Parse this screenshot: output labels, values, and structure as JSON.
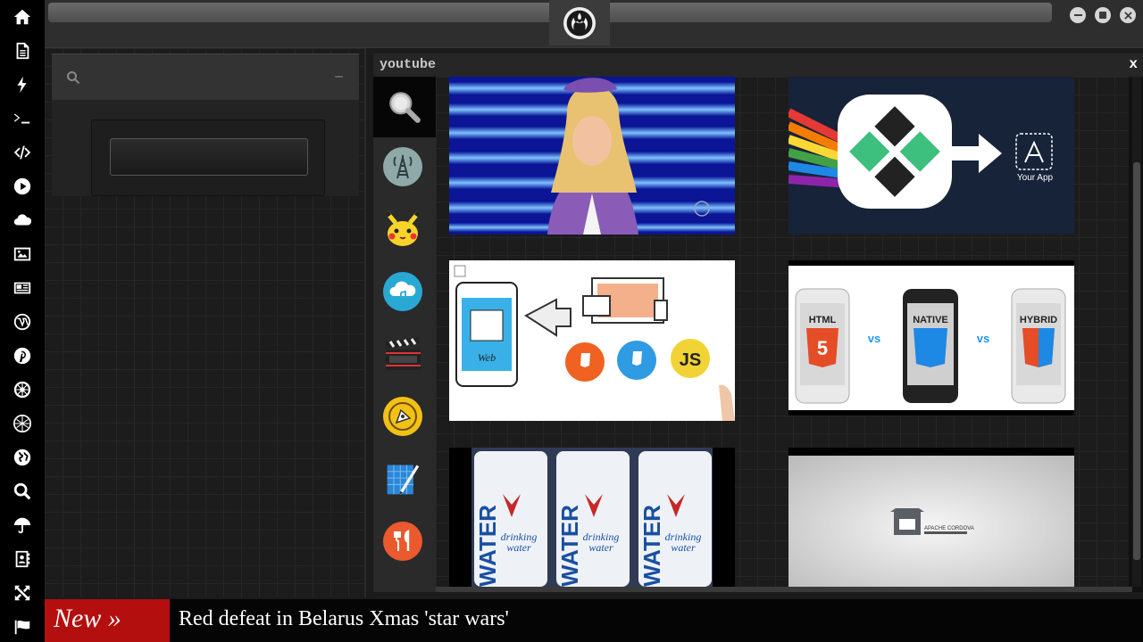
{
  "sidebar": {
    "icons": [
      "home-icon",
      "document-icon",
      "lightning-icon",
      "terminal-icon",
      "code-icon",
      "play-icon",
      "cloud-icon",
      "image-icon",
      "newspaper-icon",
      "wordpress-icon",
      "pinterest-icon",
      "aperture-icon",
      "dribbble-icon",
      "globe-icon",
      "search-icon",
      "umbrella-icon",
      "contacts-icon",
      "crossing-arrows-icon",
      "flag-icon"
    ]
  },
  "search": {
    "placeholder": "",
    "collapse_label": "–"
  },
  "window": {
    "title": "youtube",
    "close_label": "x"
  },
  "apps": [
    "search-app",
    "radio-tower-app",
    "pikachu-app",
    "cloud-music-app",
    "clapperboard-app",
    "pen-tool-app",
    "blueprint-app",
    "restaurant-app"
  ],
  "thumbnails": {
    "t2": {
      "store_label": "Your App"
    },
    "t4": {
      "label_html": "HTML",
      "label_native": "NATIVE",
      "label_hybrid": "HYBRID",
      "vs1": "vs",
      "vs2": "vs"
    },
    "t5": {
      "brand": "WATER",
      "sub1": "drinking",
      "sub2": "water"
    },
    "t6": {
      "label": "APACHE CORDOVA"
    },
    "t3": {
      "web_label": "Web",
      "js_label": "JS"
    }
  },
  "ticker": {
    "badge": "New »",
    "headline": "Red defeat in Belarus Xmas 'star wars'"
  },
  "colors": {
    "accent_red": "#b30f0f",
    "sidebar_bg": "#000000"
  }
}
